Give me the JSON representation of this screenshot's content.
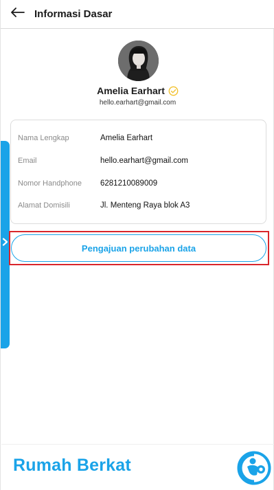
{
  "header": {
    "title": "Informasi Dasar"
  },
  "profile": {
    "name": "Amelia Earhart",
    "email": "hello.earhart@gmail.com"
  },
  "details": [
    {
      "label": "Nama Lengkap",
      "value": "Amelia Earhart"
    },
    {
      "label": "Email",
      "value": "hello.earhart@gmail.com"
    },
    {
      "label": "Nomor Handphone",
      "value": "6281210089009"
    },
    {
      "label": "Alamat Domisili",
      "value": "Jl. Menteng Raya blok A3"
    }
  ],
  "action": {
    "label": "Pengajuan perubahan data"
  },
  "footer": {
    "brand": "Rumah Berkat"
  },
  "colors": {
    "accent": "#1aa3e8",
    "verified": "#f2c230",
    "highlight": "#d9262b"
  },
  "icons": {
    "back": "arrow-left-icon",
    "verified": "check-circle-icon",
    "side_toggle": "chevron-right-icon",
    "logo": "rumah-berkat-logo"
  }
}
